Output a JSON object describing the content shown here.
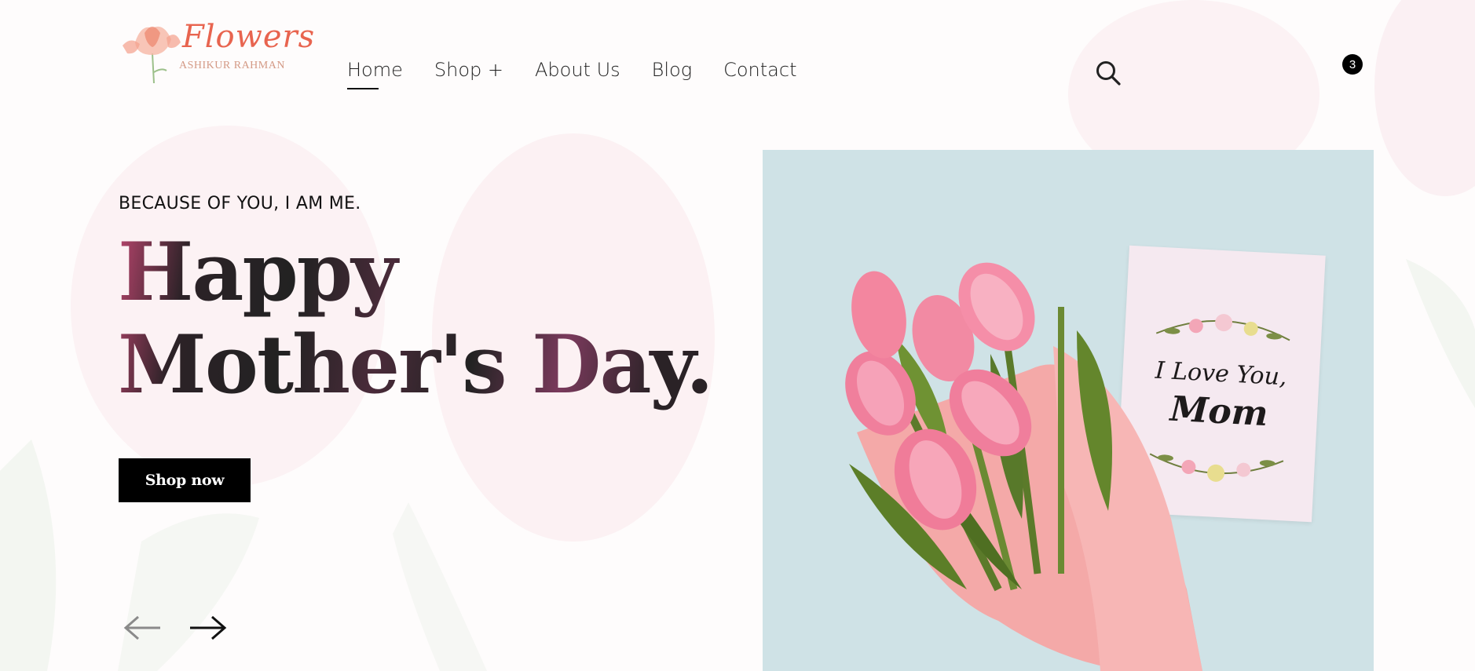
{
  "brand": {
    "name": "Flowers",
    "sub": "ASHIKUR RAHMAN"
  },
  "nav": {
    "items": [
      "Home",
      "Shop +",
      "About Us",
      "Blog",
      "Contact"
    ],
    "active": "Home"
  },
  "cart": {
    "count": "3"
  },
  "hero": {
    "eyebrow": "BECAUSE OF YOU, I AM ME.",
    "headline_line1": "Happy",
    "headline_line2": "Mother's Day.",
    "cta": "Shop now",
    "card_line1": "I Love You,",
    "card_line2": "Mom"
  },
  "colors": {
    "accent": "#000000",
    "logo": "#e8644f",
    "image_bg": "#cfe2e6"
  }
}
